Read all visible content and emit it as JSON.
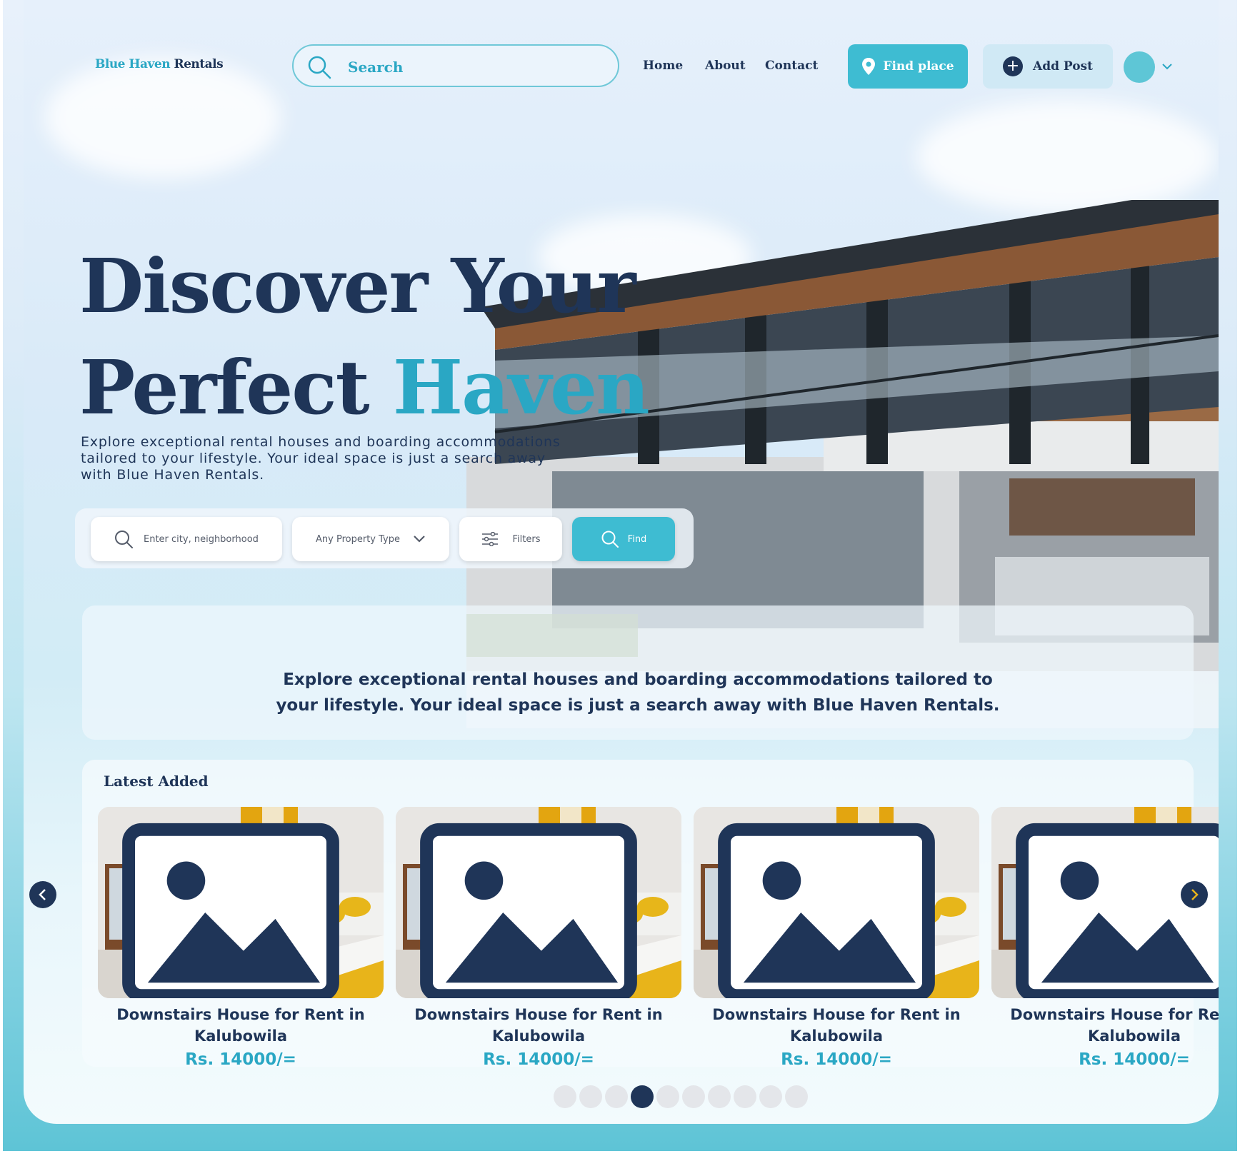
{
  "brand": {
    "name_part1": "Blue Haven",
    "name_part2": "Rentals"
  },
  "header": {
    "search_placeholder": "Search",
    "nav": [
      "Home",
      "About",
      "Contact"
    ],
    "find_place_label": "Find place",
    "add_post_label": "Add Post"
  },
  "hero": {
    "title_line1": "Discover Your",
    "title_line2_plain": "Perfect",
    "title_line2_accent": "Haven",
    "subtitle": "Explore exceptional rental houses and boarding accommodations tailored to your lifestyle. Your ideal space is just a search away with Blue Haven Rentals."
  },
  "finder": {
    "city_placeholder": "Enter city, neighborhood",
    "property_type": "Any Property Type",
    "filters_label": "Filters",
    "find_label": "Find"
  },
  "info_band": {
    "text": "Explore exceptional rental houses and boarding accommodations tailored to your lifestyle. Your ideal space is just a search away with Blue Haven Rentals."
  },
  "latest": {
    "title": "Latest Added",
    "listings": [
      {
        "title": "Downstairs House for Rent in Kalubowila",
        "price": "Rs. 14000/="
      },
      {
        "title": "Downstairs House for Rent in Kalubowila",
        "price": "Rs. 14000/="
      },
      {
        "title": "Downstairs House for Rent in Kalubowila",
        "price": "Rs. 14000/="
      },
      {
        "title": "Downstairs House for Rent in Kalubowila",
        "price": "Rs. 14000/="
      }
    ],
    "page_count": 10,
    "active_page": 4
  },
  "colors": {
    "navy": "#1f3558",
    "accent": "#2aa7c4",
    "button": "#3ebcd2"
  }
}
